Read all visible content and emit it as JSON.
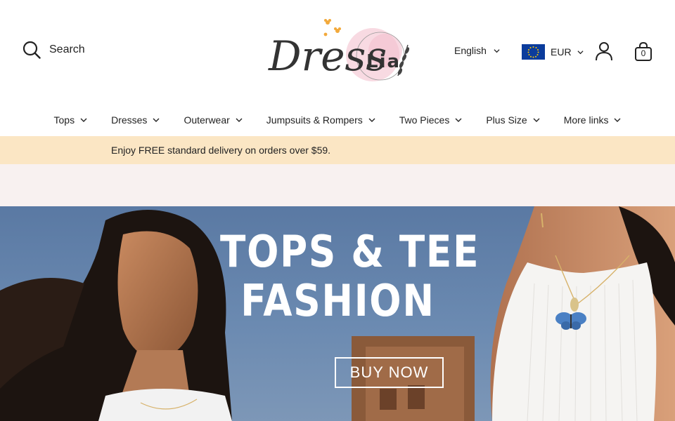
{
  "header": {
    "search_label": "Search",
    "language": "English",
    "currency": "EUR",
    "cart_count": "0"
  },
  "logo": {
    "text_left": "Dress",
    "text_right": "Lia"
  },
  "nav": {
    "items": [
      {
        "label": "Tops"
      },
      {
        "label": "Dresses"
      },
      {
        "label": "Outerwear"
      },
      {
        "label": "Jumpsuits & Rompers"
      },
      {
        "label": "Two Pieces"
      },
      {
        "label": "Plus Size"
      },
      {
        "label": "More links"
      }
    ]
  },
  "promo": {
    "text": "Enjoy FREE standard delivery on orders over $59."
  },
  "hero": {
    "headline_line1": "TOPS & TEE",
    "headline_line2": "FASHION",
    "cta": "BUY NOW"
  },
  "colors": {
    "promo_bg": "#fbe6c4",
    "spacer_bg": "#f8f1f0",
    "hero_sky": "#5a79a3",
    "flag_blue": "#0b3c9c",
    "flag_star": "#ffcc00"
  }
}
